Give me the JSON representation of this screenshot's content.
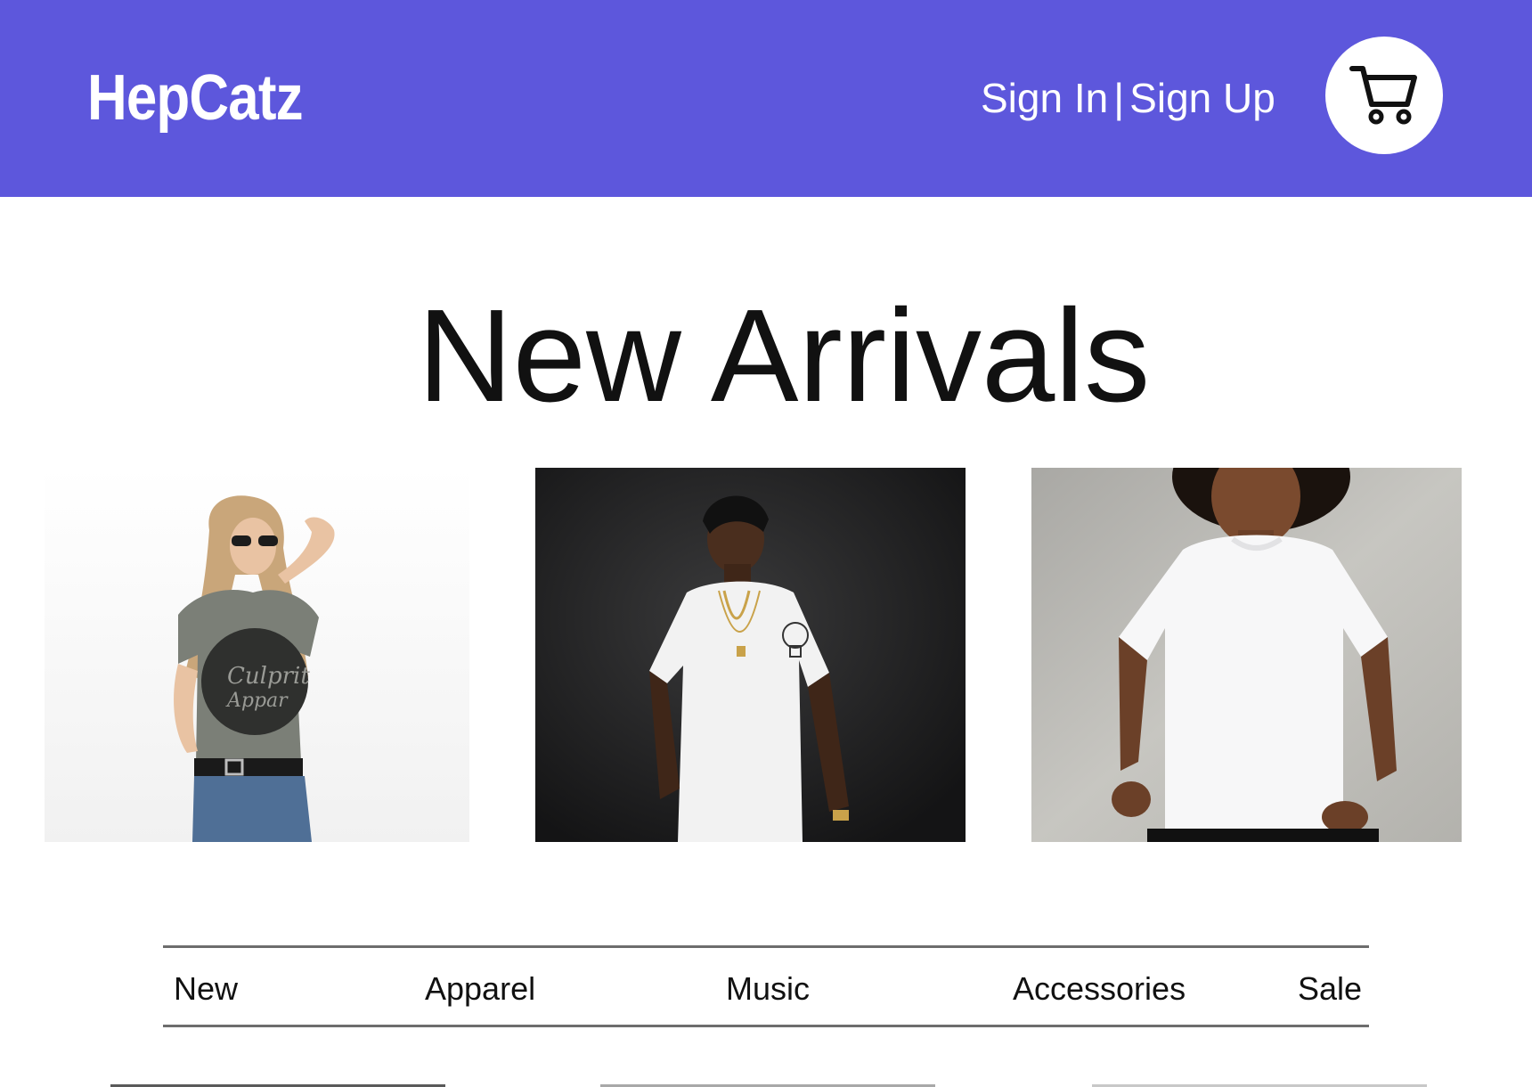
{
  "header": {
    "brand": "HepCatz",
    "sign_in": "Sign In",
    "separator": "|",
    "sign_up": "Sign Up",
    "cart_icon": "shopping-cart-icon",
    "background": "#5d57dc"
  },
  "hero": {
    "title": "New Arrivals",
    "products": [
      {
        "image": "woman-gray-graphic-tee-photo",
        "shirt_text": "Culprit Apparel"
      },
      {
        "image": "man-white-tee-dark-background-photo"
      },
      {
        "image": "woman-white-tee-concrete-wall-photo"
      }
    ]
  },
  "categories": [
    "New",
    "Apparel",
    "Music",
    "Accessories",
    "Sale"
  ]
}
